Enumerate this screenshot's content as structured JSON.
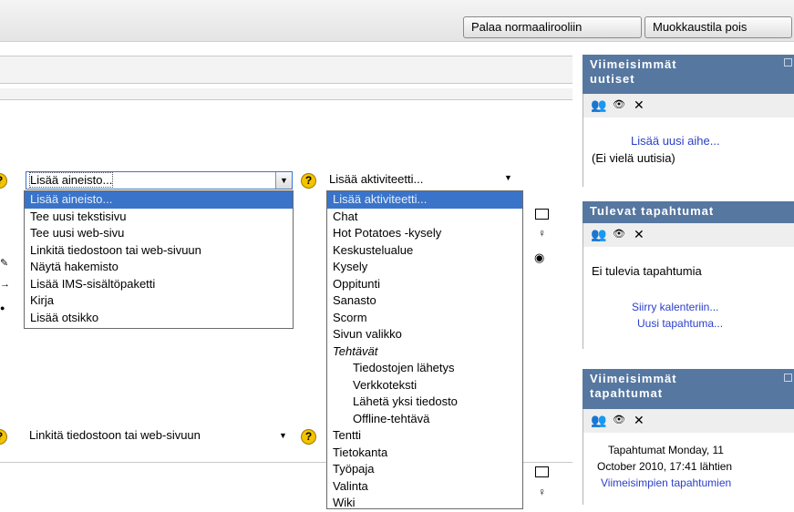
{
  "topbar": {
    "buttons": [
      "Palaa normaalirooliin",
      "Muokkaustila pois"
    ]
  },
  "resource_select": {
    "value": "Lisää aineisto...",
    "options": [
      "Lisää aineisto...",
      "Tee uusi tekstisivu",
      "Tee uusi web-sivu",
      "Linkitä tiedostoon tai web-sivuun",
      "Näytä hakemisto",
      "Lisää IMS-sisältöpaketti",
      "Kirja",
      "Lisää otsikko"
    ]
  },
  "activity_select": {
    "value": "Lisää aktiviteetti...",
    "options": [
      {
        "label": "Lisää aktiviteetti..."
      },
      {
        "label": "Chat"
      },
      {
        "label": "Hot Potatoes -kysely"
      },
      {
        "label": "Keskustelualue"
      },
      {
        "label": "Kysely"
      },
      {
        "label": "Oppitunti"
      },
      {
        "label": "Sanasto"
      },
      {
        "label": "Scorm"
      },
      {
        "label": "Sivun valikko"
      },
      {
        "label": "Tehtävät",
        "group": true
      },
      {
        "label": "Tiedostojen lähetys",
        "indent": true
      },
      {
        "label": "Verkkoteksti",
        "indent": true
      },
      {
        "label": "Lähetä yksi tiedosto",
        "indent": true
      },
      {
        "label": "Offline-tehtävä",
        "indent": true
      },
      {
        "label": "Tentti"
      },
      {
        "label": "Tietokanta"
      },
      {
        "label": "Työpaja"
      },
      {
        "label": "Valinta"
      },
      {
        "label": "Wiki"
      }
    ]
  },
  "second_resource_select": {
    "value": "Linkitä tiedostoon tai web-sivuun"
  },
  "help_symbol": "?",
  "blocks": {
    "news": {
      "title_line1": "Viimeisimmät",
      "title_line2": "uutiset",
      "add_link": "Lisää uusi aihe...",
      "empty": "(Ei vielä uutisia)"
    },
    "upcoming": {
      "title": "Tulevat tapahtumat",
      "empty": "Ei tulevia tapahtumia",
      "link1": "Siirry kalenteriin...",
      "link2": "Uusi tapahtuma..."
    },
    "recent": {
      "title_line1": "Viimeisimmät",
      "title_line2": "tapahtumat",
      "text1": "Tapahtumat Monday, 11",
      "text2": "October 2010, 17:41 lähtien",
      "link": "Viimeisimpien tapahtumien"
    }
  },
  "icons": {
    "roles": "👥",
    "hide": "👁",
    "delete": "✕",
    "block": "☐",
    "bulb": "💡"
  }
}
